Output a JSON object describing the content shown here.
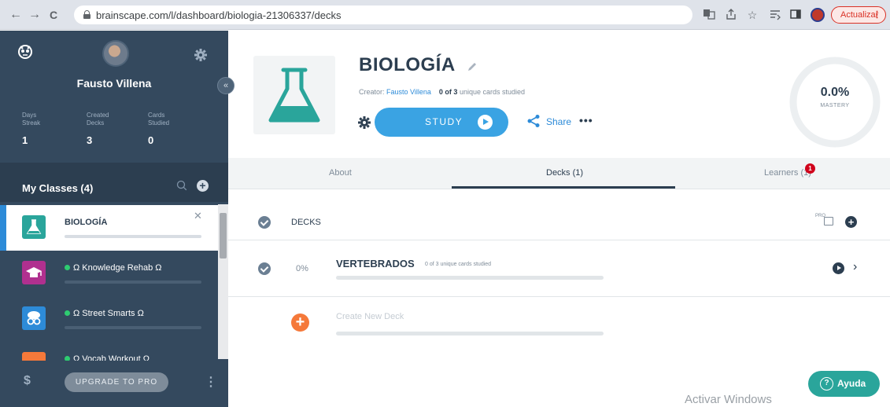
{
  "browser": {
    "url": "brainscape.com/l/dashboard/biologia-21306337/decks",
    "update_label": "Actualizar",
    "back_icon": "←",
    "forward_icon": "→",
    "reload_icon": "C"
  },
  "sidebar": {
    "user_name": "Fausto Villena",
    "stats": [
      {
        "label": "Days Streak",
        "value": "1"
      },
      {
        "label": "Created Decks",
        "value": "3"
      },
      {
        "label": "Cards Studied",
        "value": "0"
      }
    ],
    "classes_title": "My Classes (4)",
    "classes": [
      {
        "name": "BIOLOGÍA",
        "thumb_color": "#2aa59b",
        "active": true
      },
      {
        "name": "Ω Knowledge Rehab Ω",
        "thumb_color": "#b0308f",
        "active": false
      },
      {
        "name": "Ω Street Smarts Ω",
        "thumb_color": "#2d8bd8",
        "active": false
      },
      {
        "name": "Ω Vocab Workout Ω",
        "thumb_color": "#f5793a",
        "active": false
      }
    ],
    "upgrade_label": "UPGRADE TO PRO",
    "dollar": "$"
  },
  "header": {
    "title": "BIOLOGÍA",
    "creator_prefix": "Creator:",
    "creator_name": "Fausto Villena",
    "studied_count": "0 of 3",
    "studied_suffix": "unique cards studied",
    "study_label": "STUDY",
    "share_label": "Share",
    "mastery_value": "0.0%",
    "mastery_label": "MASTERY",
    "mastery_fraction": 0.0
  },
  "tabs": [
    {
      "label": "About",
      "active": false
    },
    {
      "label": "Decks (1)",
      "active": true
    },
    {
      "label": "Learners (1)",
      "active": false,
      "badge": "1"
    }
  ],
  "decks": {
    "header_label": "DECKS",
    "pro_tag": "PRO",
    "items": [
      {
        "percent": "0%",
        "name": "VERTEBRADOS",
        "studied": "0 of 3 unique cards studied",
        "progress": 0.0
      }
    ],
    "create_label": "Create New Deck"
  },
  "footer": {
    "watermark": "Activar Windows",
    "help_label": "Ayuda"
  },
  "colors": {
    "sidebar_bg": "#34495e",
    "accent_blue": "#3aa3e3",
    "flask_teal": "#2aa59b",
    "create_orange": "#f5793a",
    "badge_red": "#d0021b"
  }
}
